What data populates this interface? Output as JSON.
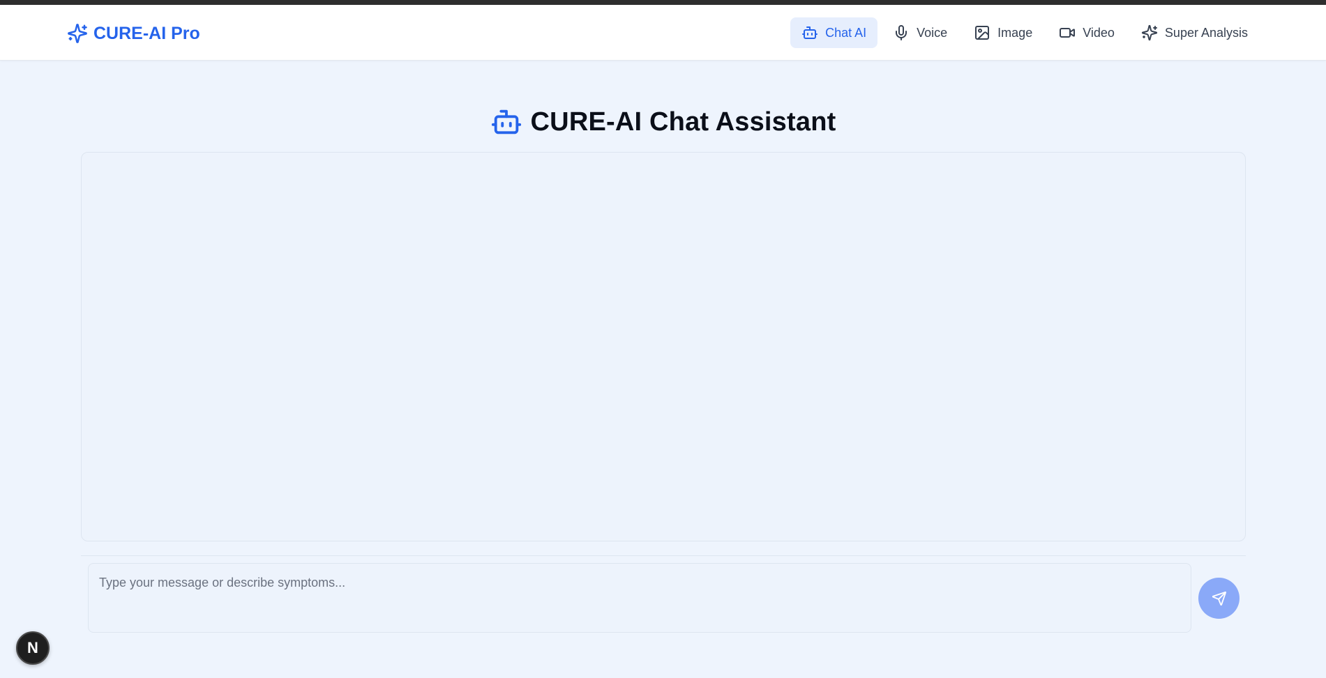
{
  "brand": {
    "name": "CURE-AI Pro",
    "icon": "sparkles-icon"
  },
  "nav": {
    "items": [
      {
        "label": "Chat AI",
        "icon": "bot-icon",
        "active": true
      },
      {
        "label": "Voice",
        "icon": "microphone-icon",
        "active": false
      },
      {
        "label": "Image",
        "icon": "image-icon",
        "active": false
      },
      {
        "label": "Video",
        "icon": "video-icon",
        "active": false
      },
      {
        "label": "Super Analysis",
        "icon": "sparkles-icon",
        "active": false
      }
    ]
  },
  "page": {
    "title": "CURE-AI Chat Assistant",
    "title_icon": "bot-icon"
  },
  "chat": {
    "messages": []
  },
  "composer": {
    "placeholder": "Type your message or describe symptoms...",
    "value": ""
  },
  "dev_badge": {
    "label": "N"
  },
  "colors": {
    "accent": "#2563eb",
    "background": "#eef4fd",
    "send_button": "#8aa9f8",
    "active_nav_bg": "#e6eefd"
  }
}
